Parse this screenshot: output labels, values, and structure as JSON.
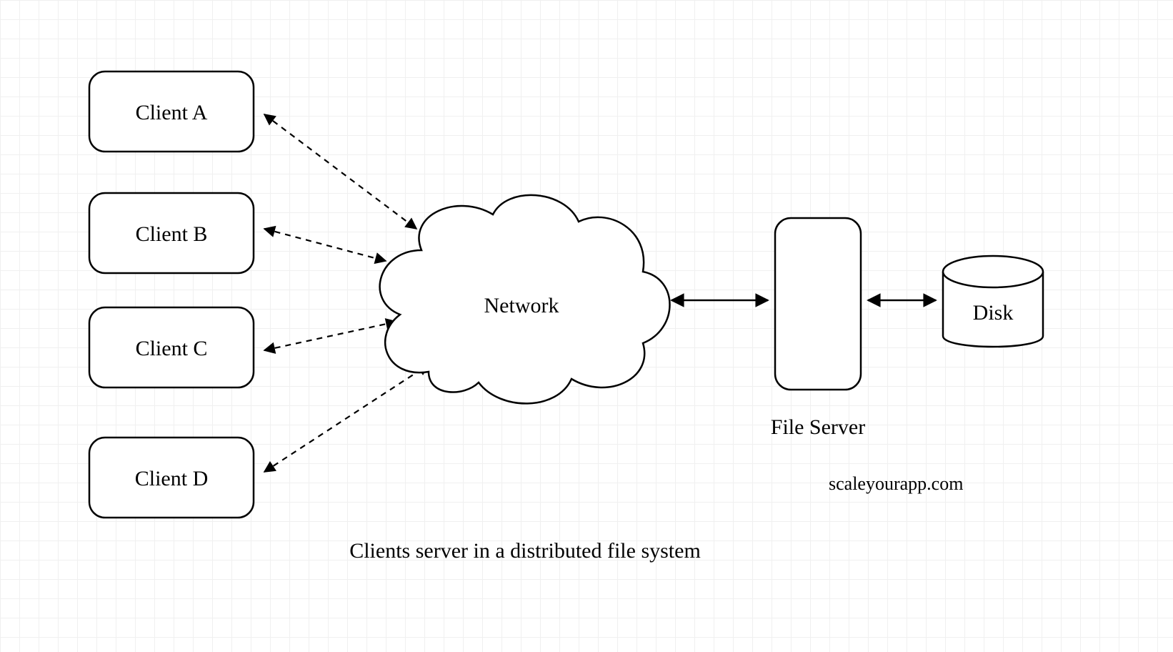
{
  "clients": [
    {
      "label": "Client A"
    },
    {
      "label": "Client B"
    },
    {
      "label": "Client C"
    },
    {
      "label": "Client D"
    }
  ],
  "network": {
    "label": "Network"
  },
  "fileserver": {
    "label": "File Server"
  },
  "disk": {
    "label": "Disk"
  },
  "caption": "Clients server in a distributed file system",
  "watermark": "scaleyourapp.com"
}
